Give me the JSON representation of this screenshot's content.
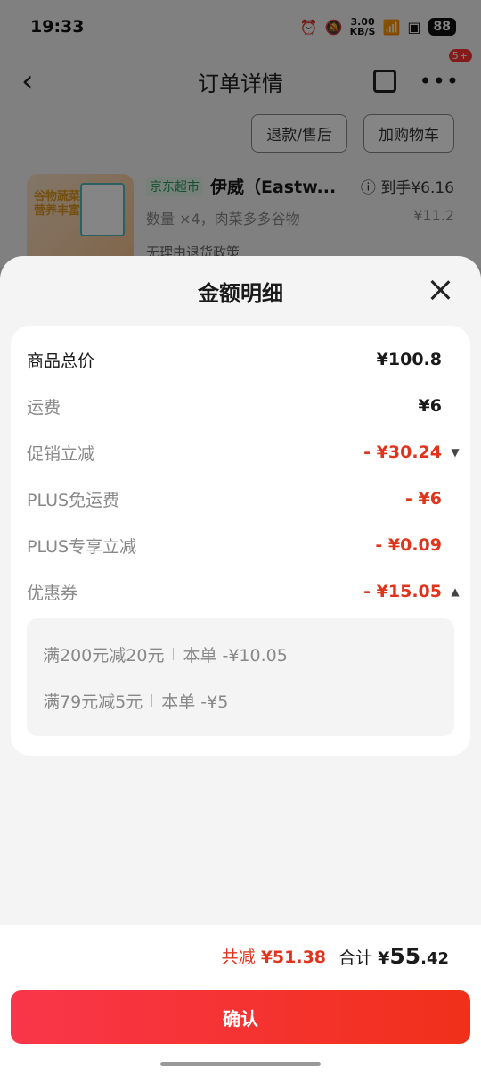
{
  "status": {
    "time": "19:33",
    "speed_value": "3.00",
    "speed_unit": "KB/S",
    "battery": "88"
  },
  "nav": {
    "title": "订单详情",
    "badge": "5+"
  },
  "actions": {
    "refund": "退款/售后",
    "add_cart": "加购物车"
  },
  "product": {
    "image_text": "谷物蔬菜肉\n营养丰富",
    "tag": "京东超市",
    "name": "伊威（Eastw...",
    "price_label": "到手¥6.16",
    "qty_spec": "数量 ×4，肉菜多多谷物",
    "orig_price": "¥11.2",
    "policy": "无理由退货政策"
  },
  "sheet": {
    "title": "金额明细",
    "rows": [
      {
        "label": "商品总价",
        "value": "¥100.8"
      },
      {
        "label": "运费",
        "value": "¥6"
      },
      {
        "label": "促销立减",
        "value": "- ¥30.24"
      },
      {
        "label": "PLUS免运费",
        "value": "- ¥6"
      },
      {
        "label": "PLUS专享立减",
        "value": "- ¥0.09"
      },
      {
        "label": "优惠券",
        "value": "- ¥15.05"
      }
    ],
    "coupons": [
      {
        "name": "满200元减20元",
        "amount": "本单 -¥10.05"
      },
      {
        "name": "满79元减5元",
        "amount": "本单 -¥5"
      }
    ]
  },
  "footer": {
    "saved_label": "共减",
    "saved_value": "¥51.38",
    "total_label": "合计",
    "total_currency": "¥",
    "total_int": "55",
    "total_dec": ".42",
    "confirm": "确认"
  },
  "colors": {
    "accent": "#e0341c",
    "button": "#f33a3a"
  }
}
